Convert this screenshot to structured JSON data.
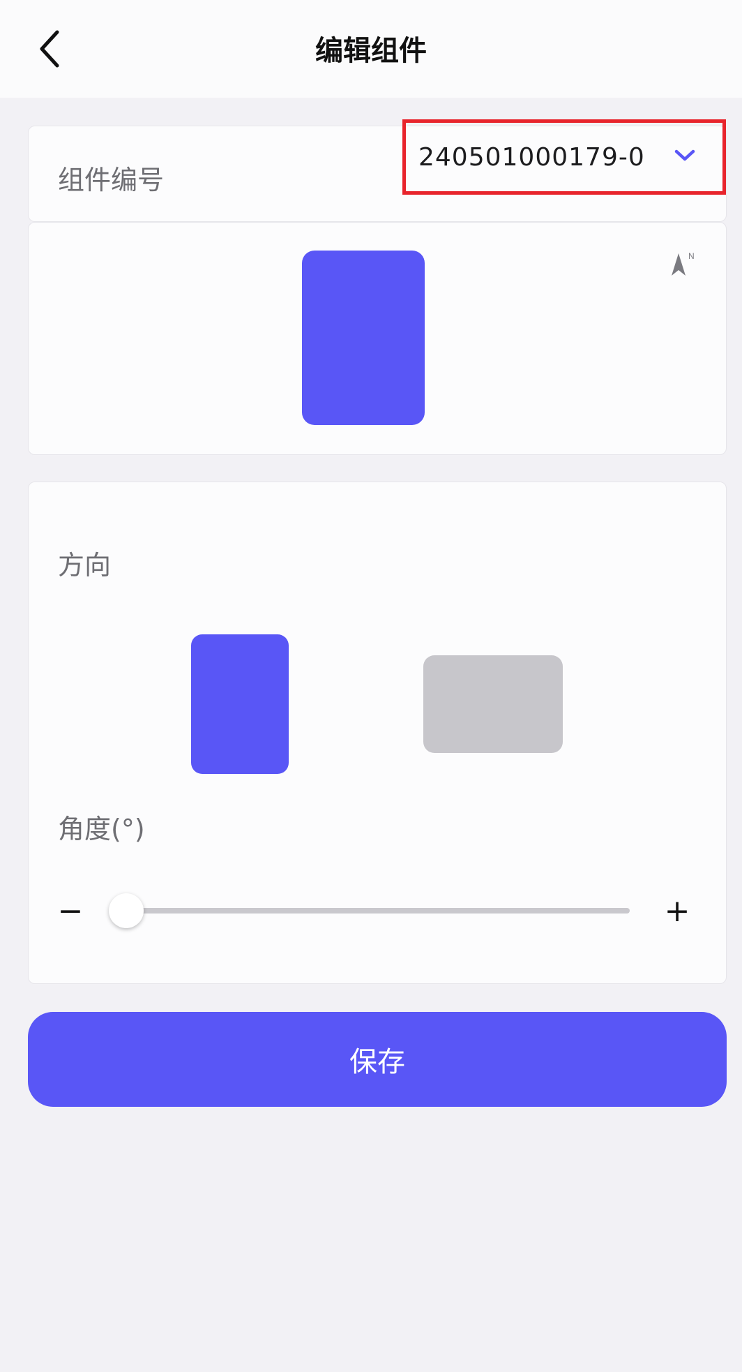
{
  "header": {
    "title": "编辑组件",
    "back_icon": "chevron-left-icon"
  },
  "component": {
    "label": "组件编号",
    "selected_id": "240501000179-0",
    "dropdown_icon": "chevron-down-icon"
  },
  "preview": {
    "orientation": "portrait",
    "compass_icon": "north-arrow-icon",
    "compass_letter": "N"
  },
  "orientation_section": {
    "label": "方向",
    "options": [
      "portrait",
      "landscape"
    ],
    "selected": "portrait"
  },
  "angle_section": {
    "label": "角度(°)",
    "minus": "−",
    "plus": "+",
    "value_fraction": 0
  },
  "actions": {
    "save_label": "保存"
  },
  "colors": {
    "accent": "#5956f6",
    "inactive": "#c7c6cb",
    "highlight_box": "#e8242c",
    "background": "#f2f1f5"
  }
}
